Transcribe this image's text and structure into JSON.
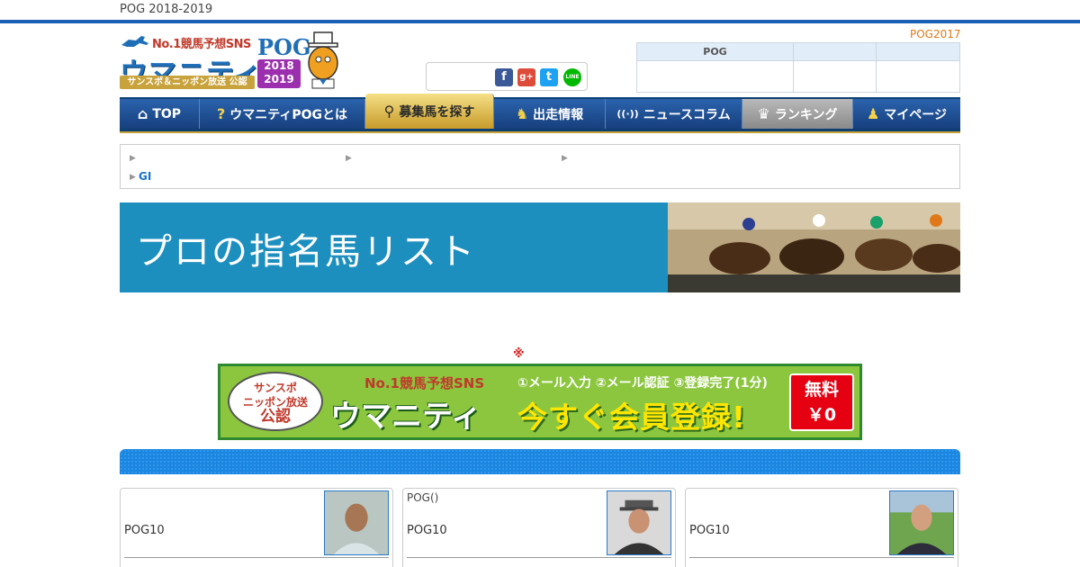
{
  "topbar": {
    "title": "POG 2018-2019"
  },
  "logo": {
    "no1": "No.1競馬予想SNS",
    "brand": "ウマニティ",
    "sub": "サンスポ＆ニッポン放送 公認",
    "pog": "POG",
    "year1": "2018",
    "year2": "2019"
  },
  "share": {
    "icons": [
      "facebook-icon",
      "googleplus-icon",
      "twitter-icon",
      "line-icon"
    ],
    "fb": "f",
    "gp": "g+",
    "tw": "t",
    "line": "LINE"
  },
  "header": {
    "pog2017_link": "POG2017",
    "table_header": "POG"
  },
  "nav": {
    "items": [
      {
        "label": "TOP",
        "icon": "⌂"
      },
      {
        "label": "ウマニティPOGとは",
        "icon": "?"
      },
      {
        "label": "募集馬を探す",
        "icon": "⚲"
      },
      {
        "label": "出走情報",
        "icon": "♞"
      },
      {
        "label": "ニュースコラム",
        "icon": "((·))"
      },
      {
        "label": "ランキング",
        "icon": "♛"
      },
      {
        "label": "マイページ",
        "icon": "♟"
      }
    ]
  },
  "breadcrumb": {
    "gi": "GI"
  },
  "banner": {
    "title": "プロの指名馬リスト"
  },
  "kome": "※",
  "register": {
    "oval_line1": "サンスポ",
    "oval_line2": "ニッポン放送",
    "oval_line3": "公認",
    "no1": "No.1競馬予想SNS",
    "brand": "ウマニティ",
    "steps": "①メール入力 ②メール認証 ③登録完了(1分)",
    "cta": "今すぐ会員登録!",
    "free1": "無料",
    "free2": "￥0"
  },
  "cards": [
    {
      "sub": "",
      "label": "POG10"
    },
    {
      "sub": "POG()",
      "label": "POG10"
    },
    {
      "sub": "",
      "label": "POG10"
    }
  ],
  "colors": {
    "brand_blue": "#1a5fb4",
    "banner_blue": "#1d8fbf",
    "accent_orange": "#e0781a",
    "reg_green": "#8cc63f"
  }
}
